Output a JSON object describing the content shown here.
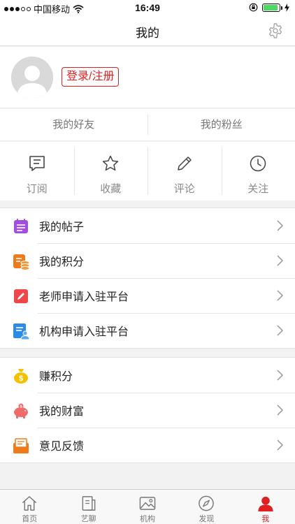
{
  "status_bar": {
    "carrier": "中国移动",
    "time": "16:49"
  },
  "nav": {
    "title": "我的"
  },
  "profile": {
    "login_label": "登录/注册"
  },
  "social": [
    {
      "label": "我的好友"
    },
    {
      "label": "我的粉丝"
    }
  ],
  "actions": [
    {
      "label": "订阅",
      "icon": "subscribe-icon"
    },
    {
      "label": "收藏",
      "icon": "star-icon"
    },
    {
      "label": "评论",
      "icon": "pencil-icon"
    },
    {
      "label": "关注",
      "icon": "clock-icon"
    }
  ],
  "menu_group1": [
    {
      "label": "我的帖子",
      "icon": "posts-icon",
      "color": "#a14fe0"
    },
    {
      "label": "我的积分",
      "icon": "points-icon",
      "color": "#f07a1a"
    },
    {
      "label": "老师申请入驻平台",
      "icon": "teacher-apply-icon",
      "color": "#ef4747"
    },
    {
      "label": "机构申请入驻平台",
      "icon": "institution-apply-icon",
      "color": "#2a8be8"
    }
  ],
  "menu_group2": [
    {
      "label": "赚积分",
      "icon": "money-bag-icon",
      "color": "#f5c000"
    },
    {
      "label": "我的财富",
      "icon": "piggy-bank-icon",
      "color": "#f06b6b"
    },
    {
      "label": "意见反馈",
      "icon": "feedback-icon",
      "color": "#f07a1a"
    }
  ],
  "tabbar": [
    {
      "label": "首页",
      "icon": "home-icon"
    },
    {
      "label": "艺聊",
      "icon": "chat-icon"
    },
    {
      "label": "机构",
      "icon": "image-icon"
    },
    {
      "label": "发现",
      "icon": "compass-icon"
    },
    {
      "label": "我",
      "icon": "person-icon",
      "active": true
    }
  ],
  "colors": {
    "accent": "#e02020",
    "battery": "#4cd964"
  }
}
